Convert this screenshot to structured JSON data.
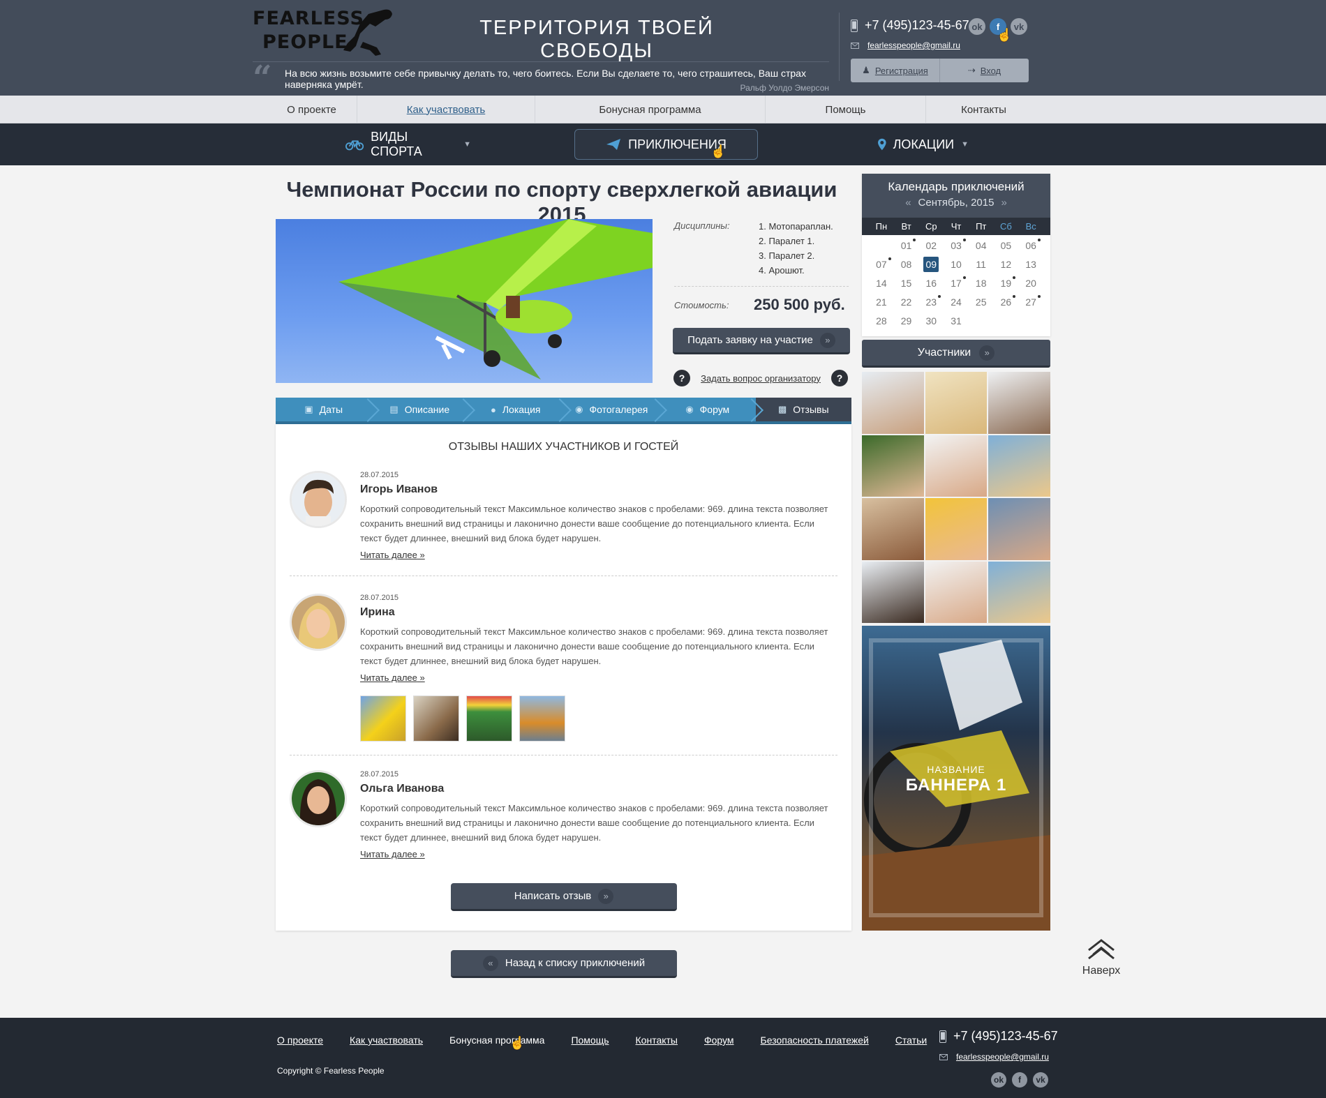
{
  "header": {
    "logo_line1": "FEARLESS",
    "logo_line2": "PEOPLE",
    "slogan": "ТЕРРИТОРИЯ ТВОЕЙ СВОБОДЫ",
    "quote": "На всю жизнь возьмите себе привычку делать то, чего боитесь. Если Вы сделаете то, чего страшитесь, Ваш страх наверняка умрёт.",
    "quote_author": "Ральф Уолдо Эмерсон",
    "phone": "+7 (495)123-45-67",
    "email": "fearlesspeople@gmail.ru",
    "register_label": "Регистрация",
    "login_label": "Вход",
    "social_icons": [
      "odnoklassniki-icon",
      "facebook-icon",
      "vk-icon"
    ]
  },
  "topnav": {
    "items": [
      "О проекте",
      "Как участвовать",
      "Бонусная программа",
      "Помощь",
      "Контакты"
    ],
    "active_index": 1
  },
  "categories": {
    "items": [
      {
        "label": "ВИДЫ СПОРТА",
        "icon": "bicycle-icon"
      },
      {
        "label": "ПРИКЛЮЧЕНИЯ",
        "icon": "paper-plane-icon"
      },
      {
        "label": "ЛОКАЦИИ",
        "icon": "map-pin-icon"
      }
    ],
    "active_index": 1
  },
  "event": {
    "title": "Чемпионат России по спорту сверхлегкой авиации 2015",
    "disciplines_label": "Дисциплины:",
    "disciplines": [
      "1. Мотопараплан.",
      "2. Паралет 1.",
      "3. Паралет 2.",
      "4. Арошют."
    ],
    "cost_label": "Стоимость:",
    "cost_value": "250 500 руб.",
    "apply_label": "Подать заявку на участие",
    "ask_label": "Задать вопрос организатору"
  },
  "tabs": {
    "items": [
      {
        "label": "Даты",
        "icon": "calendar-icon"
      },
      {
        "label": "Описание",
        "icon": "document-icon"
      },
      {
        "label": "Локация",
        "icon": "map-pin-icon"
      },
      {
        "label": "Фотогалерея",
        "icon": "camera-icon"
      },
      {
        "label": "Форум",
        "icon": "chat-bubbles-icon"
      },
      {
        "label": "Отзывы",
        "icon": "comment-icon"
      }
    ],
    "active_index": 5
  },
  "reviews": {
    "title": "ОТЗЫВЫ НАШИХ УЧАСТНИКОВ И ГОСТЕЙ",
    "read_more": "Читать далее",
    "items": [
      {
        "date": "28.07.2015",
        "name": "Игорь Иванов",
        "text": "Короткий сопроводительный текст Максимльное количество знаков с пробелами: 969. длина текста позволяет сохранить внешний вид страницы и лаконично донести ваше сообщение до потенциального клиента. Если текст будет длиннее, внешний вид блока будет нарушен."
      },
      {
        "date": "28.07.2015",
        "name": "Ирина",
        "text": "Короткий сопроводительный текст Максимльное количество знаков с пробелами: 969. длина текста позволяет сохранить внешний вид страницы и лаконично донести ваше сообщение до потенциального клиента. Если текст будет длиннее, внешний вид блока будет нарушен."
      },
      {
        "date": "28.07.2015",
        "name": "Ольга Иванова",
        "text": "Короткий сопроводительный текст Максимльное количество знаков с пробелами: 969. длина текста позволяет сохранить внешний вид страницы и лаконично донести ваше сообщение до потенциального клиента. Если текст будет длиннее, внешний вид блока будет нарушен."
      }
    ],
    "write_label": "Написать отзыв",
    "back_label": "Назад к списку приключений"
  },
  "calendar": {
    "title": "Календарь приключений",
    "month": "Сентябрь, 2015",
    "dow": [
      "Пн",
      "Вт",
      "Ср",
      "Чт",
      "Пт",
      "Сб",
      "Вс"
    ],
    "days": [
      "",
      "01",
      "02",
      "03",
      "04",
      "05",
      "06",
      "07",
      "08",
      "09",
      "10",
      "11",
      "12",
      "13",
      "14",
      "15",
      "16",
      "17",
      "18",
      "19",
      "20",
      "21",
      "22",
      "23",
      "24",
      "25",
      "26",
      "27",
      "28",
      "29",
      "30",
      "31"
    ],
    "today": "09",
    "event_days": [
      "01",
      "03",
      "06",
      "07",
      "17",
      "19",
      "23",
      "26",
      "27"
    ]
  },
  "sidebar": {
    "participants_label": "Участники",
    "banner_sub": "НАЗВАНИЕ",
    "banner_title": "БАННЕРА 1",
    "to_top": "Наверх"
  },
  "footer": {
    "nav": [
      "О проекте",
      "Как участвовать",
      "Бонусная программа",
      "Помощь",
      "Контакты",
      "Форум",
      "Безопасность платежей",
      "Статьи"
    ],
    "copyright": "Copyright ©  Fearless People",
    "phone": "+7 (495)123-45-67",
    "email": "fearlesspeople@gmail.ru"
  },
  "colors": {
    "header_bg": "#434c5a",
    "catbar_bg": "#262d38",
    "tab_blue": "#3f8fbd",
    "accent_today": "#26557e",
    "footer_bg": "#232932"
  }
}
